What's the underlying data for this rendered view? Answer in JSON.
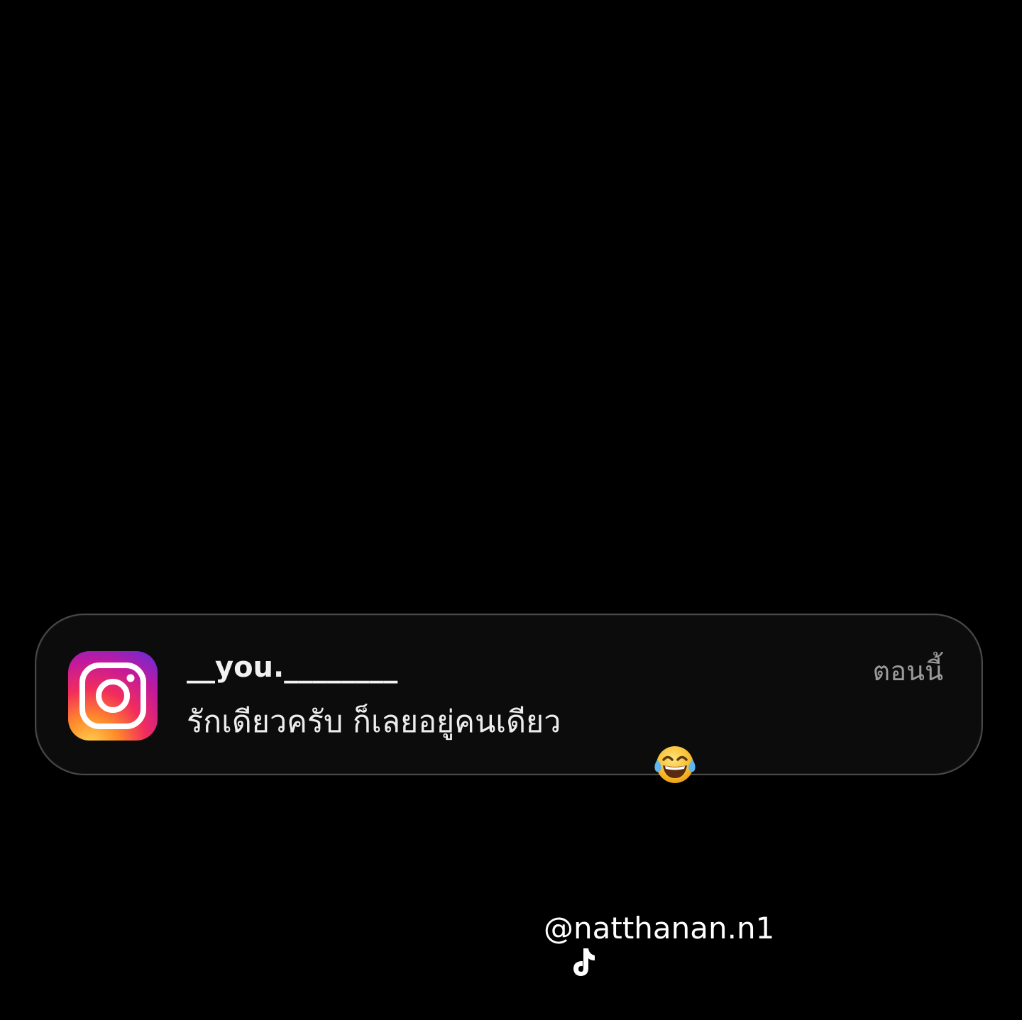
{
  "notification": {
    "app_icon": "instagram-icon",
    "sender": "__you.________",
    "message": "รักเดียวครับ ก็เลยอยู่คนเดียว",
    "message_emoji": "face-with-tears-of-joy-emoji",
    "timestamp": "ตอนนี้"
  },
  "watermark": {
    "icon": "tiktok-icon",
    "handle": "@natthanan.n1"
  },
  "colors": {
    "background": "#000000",
    "card": "#0c0c0c",
    "text_primary": "#f2f2f2",
    "text_secondary": "#9a9a9a"
  }
}
